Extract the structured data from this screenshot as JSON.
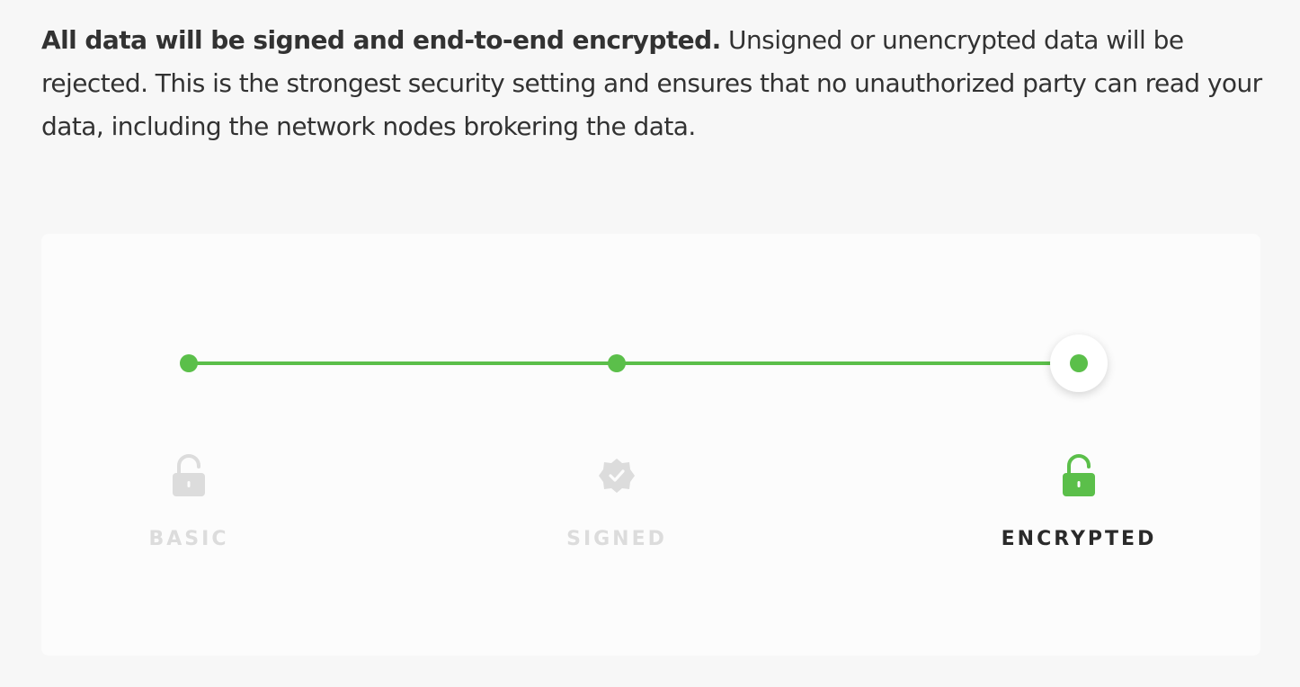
{
  "description": {
    "bold": "All data will be signed and end-to-end encrypted.",
    "rest": " Unsigned or unencrypted data will be rejected. This is the strongest security setting and ensures that no unauthorized party can read your data, including the network nodes brokering the data."
  },
  "security_slider": {
    "selected": "ENCRYPTED",
    "accent_color": "#5bbf4a",
    "inactive_color": "#dcdcdc",
    "levels": [
      {
        "label": "BASIC",
        "icon": "unlock-icon"
      },
      {
        "label": "SIGNED",
        "icon": "verified-badge-icon"
      },
      {
        "label": "ENCRYPTED",
        "icon": "unlock-icon"
      }
    ]
  }
}
